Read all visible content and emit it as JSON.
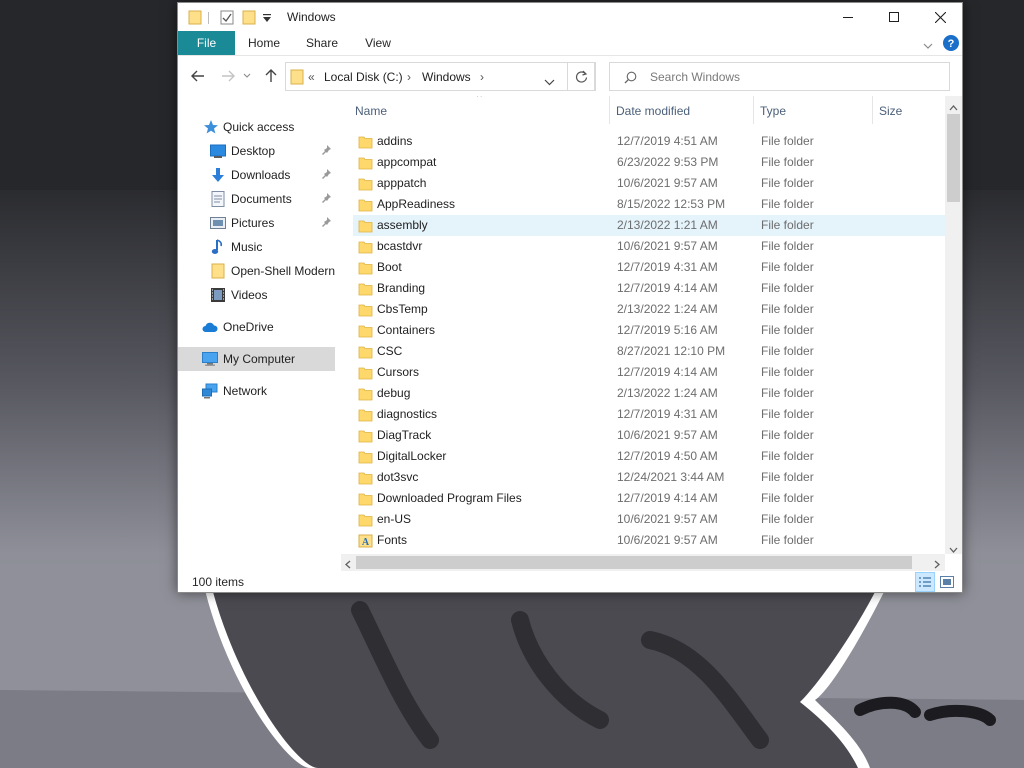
{
  "window": {
    "title": "Windows",
    "minimize_glyph": "—",
    "close_glyph": "✕"
  },
  "ribbon": {
    "tabs": [
      "File",
      "Home",
      "Share",
      "View"
    ]
  },
  "address_bar": {
    "overflow": "«",
    "segments": [
      "Local Disk (C:)",
      "Windows"
    ],
    "separator": "›"
  },
  "search": {
    "placeholder": "Search Windows"
  },
  "nav_pane": {
    "items": [
      {
        "label": "Quick access",
        "icon": "star-icon"
      },
      {
        "label": "Desktop",
        "icon": "desktop-icon",
        "pinned": true
      },
      {
        "label": "Downloads",
        "icon": "download-arrow-icon",
        "pinned": true
      },
      {
        "label": "Documents",
        "icon": "document-icon",
        "pinned": true
      },
      {
        "label": "Pictures",
        "icon": "picture-icon",
        "pinned": true
      },
      {
        "label": "Music",
        "icon": "music-note-icon"
      },
      {
        "label": "Open-Shell Modern",
        "icon": "folder-icon"
      },
      {
        "label": "Videos",
        "icon": "film-icon"
      },
      {
        "label": "OneDrive",
        "icon": "cloud-icon"
      },
      {
        "label": "My Computer",
        "icon": "computer-icon",
        "selected": true
      },
      {
        "label": "Network",
        "icon": "network-icon"
      }
    ]
  },
  "file_list": {
    "columns": [
      "Name",
      "Date modified",
      "Type",
      "Size"
    ],
    "sort_indicator": "^",
    "rows": [
      {
        "name": "addins",
        "date": "12/7/2019 4:51 AM",
        "type": "File folder"
      },
      {
        "name": "appcompat",
        "date": "6/23/2022 9:53 PM",
        "type": "File folder"
      },
      {
        "name": "apppatch",
        "date": "10/6/2021 9:57 AM",
        "type": "File folder"
      },
      {
        "name": "AppReadiness",
        "date": "8/15/2022 12:53 PM",
        "type": "File folder"
      },
      {
        "name": "assembly",
        "date": "2/13/2022 1:21 AM",
        "type": "File folder",
        "highlighted": true
      },
      {
        "name": "bcastdvr",
        "date": "10/6/2021 9:57 AM",
        "type": "File folder"
      },
      {
        "name": "Boot",
        "date": "12/7/2019 4:31 AM",
        "type": "File folder"
      },
      {
        "name": "Branding",
        "date": "12/7/2019 4:14 AM",
        "type": "File folder"
      },
      {
        "name": "CbsTemp",
        "date": "2/13/2022 1:24 AM",
        "type": "File folder"
      },
      {
        "name": "Containers",
        "date": "12/7/2019 5:16 AM",
        "type": "File folder"
      },
      {
        "name": "CSC",
        "date": "8/27/2021 12:10 PM",
        "type": "File folder"
      },
      {
        "name": "Cursors",
        "date": "12/7/2019 4:14 AM",
        "type": "File folder"
      },
      {
        "name": "debug",
        "date": "2/13/2022 1:24 AM",
        "type": "File folder"
      },
      {
        "name": "diagnostics",
        "date": "12/7/2019 4:31 AM",
        "type": "File folder"
      },
      {
        "name": "DiagTrack",
        "date": "10/6/2021 9:57 AM",
        "type": "File folder"
      },
      {
        "name": "DigitalLocker",
        "date": "12/7/2019 4:50 AM",
        "type": "File folder"
      },
      {
        "name": "dot3svc",
        "date": "12/24/2021 3:44 AM",
        "type": "File folder"
      },
      {
        "name": "Downloaded Program Files",
        "date": "12/7/2019 4:14 AM",
        "type": "File folder"
      },
      {
        "name": "en-US",
        "date": "10/6/2021 9:57 AM",
        "type": "File folder"
      },
      {
        "name": "Fonts",
        "date": "10/6/2021 9:57 AM",
        "type": "File folder",
        "icon": "fonts-folder-icon"
      }
    ]
  },
  "status_bar": {
    "item_count": "100 items"
  },
  "colors": {
    "file_tab": "#1a8a96",
    "folder": "#ffd86b",
    "selection": "#e5f3fb",
    "nav_selected": "#d9d9d9"
  }
}
